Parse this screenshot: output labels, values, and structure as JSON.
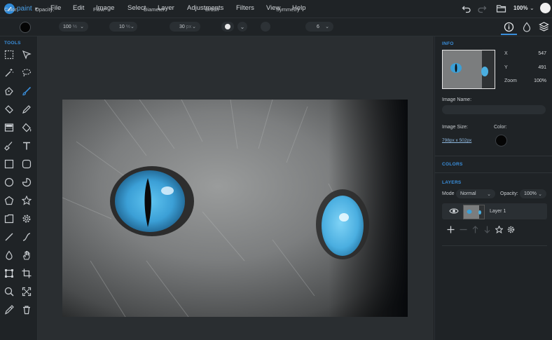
{
  "app": {
    "name": "paint"
  },
  "menu": [
    "File",
    "Edit",
    "Image",
    "Select",
    "Layer",
    "Adjustments",
    "Filters",
    "View",
    "Help"
  ],
  "topbar": {
    "zoom": "100%"
  },
  "toolbar": {
    "color_label": "Color:",
    "opacity_label": "Opacity:",
    "opacity_value": "100",
    "opacity_unit": "%",
    "flow_label": "Flow:",
    "flow_value": "10",
    "flow_unit": "%",
    "diameter_label": "Diameter:",
    "diameter_value": "30",
    "diameter_unit": "px",
    "brush_label": "Brush",
    "symmetry_label": "Symmetry",
    "symmetry_value": "6"
  },
  "tools": {
    "title": "TOOLS"
  },
  "info": {
    "title": "INFO",
    "x_label": "X",
    "x_value": "547",
    "y_label": "Y",
    "y_value": "491",
    "zoom_label": "Zoom",
    "zoom_value": "100%",
    "image_name_label": "Image Name:",
    "image_size_label": "Image Size:",
    "image_size_value": "798px x 502px",
    "color_label": "Color:"
  },
  "colors": {
    "title": "COLORS"
  },
  "layers": {
    "title": "LAYERS",
    "mode_label": "Mode",
    "mode_value": "Normal",
    "opacity_label": "Opacity:",
    "opacity_value": "100%",
    "layer_name": "Layer 1"
  },
  "palette": {
    "accent": "#3a8fdc",
    "bg": "#1f2326",
    "canvas_bg": "#2a2e31",
    "brush_color": "#050505"
  }
}
